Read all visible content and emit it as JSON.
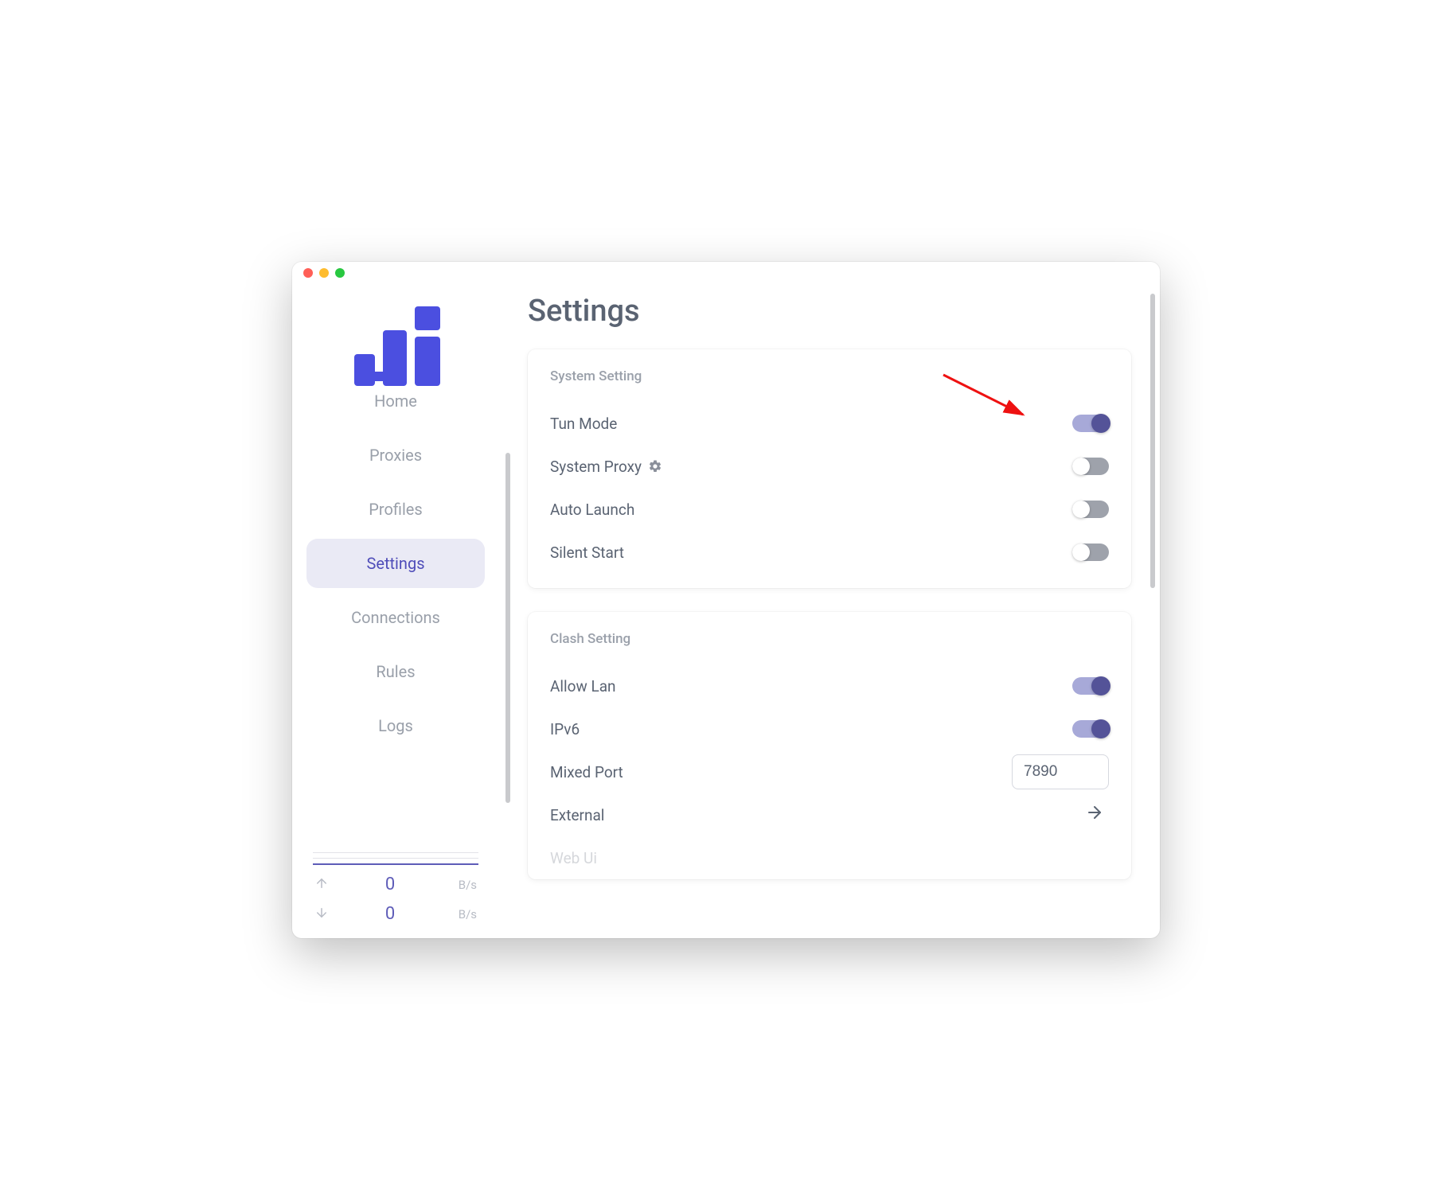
{
  "page": {
    "title": "Settings"
  },
  "sidebar": {
    "items": [
      {
        "label": "Home"
      },
      {
        "label": "Proxies"
      },
      {
        "label": "Profiles"
      },
      {
        "label": "Settings"
      },
      {
        "label": "Connections"
      },
      {
        "label": "Rules"
      },
      {
        "label": "Logs"
      }
    ],
    "traffic": {
      "up": {
        "value": "0",
        "unit": "B/s"
      },
      "down": {
        "value": "0",
        "unit": "B/s"
      }
    }
  },
  "system_setting": {
    "title": "System Setting",
    "rows": {
      "tun_mode": {
        "label": "Tun Mode",
        "on": true
      },
      "system_proxy": {
        "label": "System Proxy",
        "on": false
      },
      "auto_launch": {
        "label": "Auto Launch",
        "on": false
      },
      "silent_start": {
        "label": "Silent Start",
        "on": false
      }
    }
  },
  "clash_setting": {
    "title": "Clash Setting",
    "rows": {
      "allow_lan": {
        "label": "Allow Lan",
        "on": true
      },
      "ipv6": {
        "label": "IPv6",
        "on": true
      },
      "mixed_port": {
        "label": "Mixed Port",
        "value": "7890"
      },
      "external": {
        "label": "External"
      },
      "web_ui": {
        "label": "Web Ui"
      }
    }
  },
  "colors": {
    "accent": "#5452a3",
    "brand": "#4b4fe0"
  }
}
